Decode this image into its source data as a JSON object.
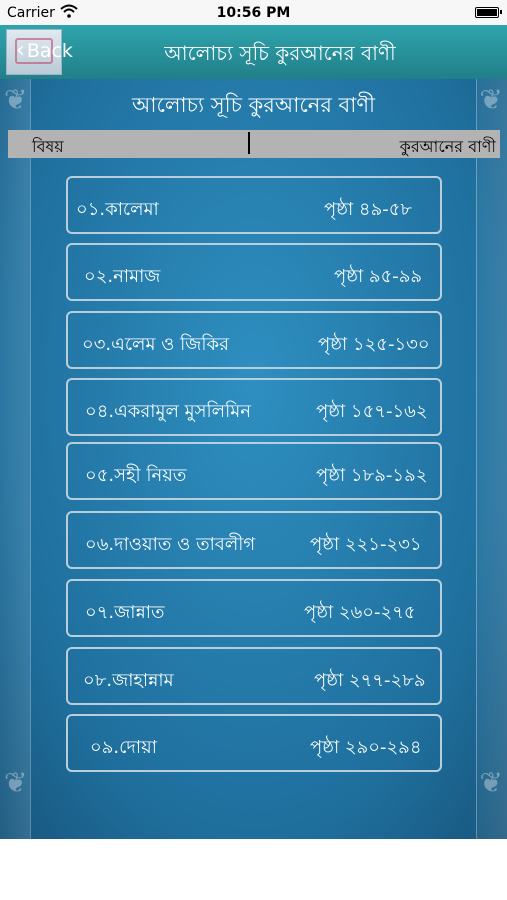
{
  "status_bar": {
    "carrier": "Carrier",
    "time": "10:56 PM"
  },
  "nav": {
    "back_label": "Back",
    "title": "আলোচ্য সূচি কুরআনের বাণী"
  },
  "content": {
    "heading": "আলোচ্য সূচি কুরআনের বাণী",
    "header": {
      "left": "বিষয়",
      "right": "কুরআনের বাণী"
    },
    "items": [
      {
        "label": "০১.কালেমা",
        "page": "পৃষ্ঠা ৪৯-৫৮"
      },
      {
        "label": "০২.নামাজ",
        "page": "পৃষ্ঠা ৯৫-৯৯"
      },
      {
        "label": "০৩.এলেম ও জিকির",
        "page": "পৃষ্ঠা ১২৫-১৩০"
      },
      {
        "label": "০৪.একরামুল মুসলিমিন",
        "page": "পৃষ্ঠা ১৫৭-১৬২"
      },
      {
        "label": "০৫.সহী নিয়ত",
        "page": "পৃষ্ঠা ১৮৯-১৯২"
      },
      {
        "label": "০৬.দাওয়াত ও তাবলীগ",
        "page": "পৃষ্ঠা ২২১-২৩১"
      },
      {
        "label": "০৭.জান্নাত",
        "page": "পৃষ্ঠা  ২৬০-২৭৫"
      },
      {
        "label": "০৮.জাহান্নাম",
        "page": "পৃষ্ঠা ২৭৭-২৮৯"
      },
      {
        "label": "০৯.দোয়া",
        "page": "পৃষ্ঠা ২৯০-২৯৪"
      }
    ]
  }
}
